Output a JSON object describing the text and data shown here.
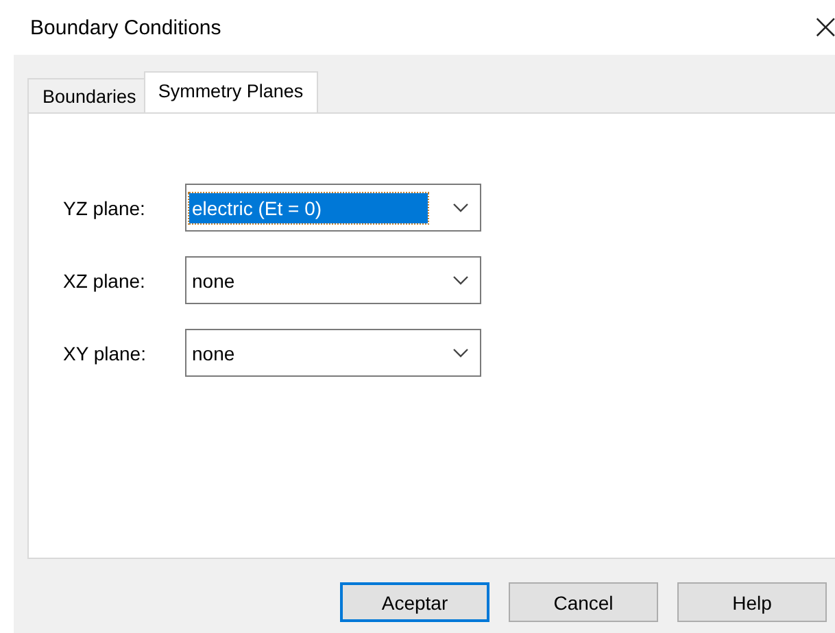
{
  "window": {
    "title": "Boundary Conditions",
    "close": "×"
  },
  "tabs": [
    {
      "label": "Boundaries",
      "selected": false
    },
    {
      "label": "Symmetry Planes",
      "selected": true
    }
  ],
  "planes": [
    {
      "label": "YZ plane:",
      "value": "electric (Et = 0)",
      "focused": true
    },
    {
      "label": "XZ plane:",
      "value": "none",
      "focused": false
    },
    {
      "label": "XY plane:",
      "value": "none",
      "focused": false
    }
  ],
  "buttons": [
    {
      "label": "Aceptar",
      "default": true
    },
    {
      "label": "Cancel",
      "default": false
    },
    {
      "label": "Help",
      "default": false
    }
  ]
}
